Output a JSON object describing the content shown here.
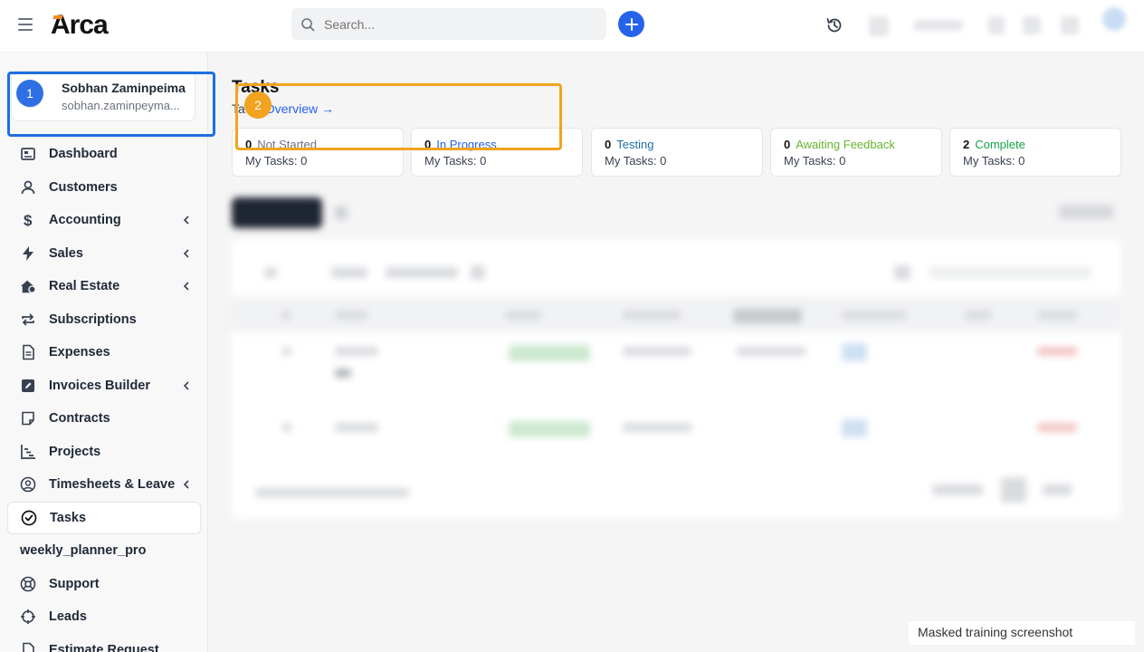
{
  "app": {
    "logo_text": "Arca",
    "search_placeholder": "Search..."
  },
  "user": {
    "name": "Sobhan Zaminpeima",
    "email": "sobhan.zaminpeyma..."
  },
  "badges": {
    "one": "1",
    "two": "2"
  },
  "sidebar": {
    "items": [
      {
        "label": "Dashboard",
        "icon": "dashboard-icon"
      },
      {
        "label": "Customers",
        "icon": "user-icon"
      },
      {
        "label": "Accounting",
        "icon": "dollar-icon",
        "has_children": true
      },
      {
        "label": "Sales",
        "icon": "bolt-icon",
        "has_children": true
      },
      {
        "label": "Real Estate",
        "icon": "house-icon",
        "has_children": true
      },
      {
        "label": "Subscriptions",
        "icon": "repeat-icon"
      },
      {
        "label": "Expenses",
        "icon": "file-icon"
      },
      {
        "label": "Invoices Builder",
        "icon": "edit-icon",
        "has_children": true
      },
      {
        "label": "Contracts",
        "icon": "note-icon"
      },
      {
        "label": "Projects",
        "icon": "chart-icon"
      },
      {
        "label": "Timesheets & Leave",
        "icon": "user-circle-icon",
        "has_children": true
      },
      {
        "label": "Tasks",
        "icon": "check-circle-icon",
        "active": true
      },
      {
        "label": "weekly_planner_pro",
        "icon": ""
      },
      {
        "label": "Support",
        "icon": "lifebuoy-icon"
      },
      {
        "label": "Leads",
        "icon": "crosshair-icon"
      },
      {
        "label": "Estimate Request",
        "icon": "file-icon"
      }
    ]
  },
  "main": {
    "title": "Tasks",
    "overview_prefix": "Ta",
    "overview_link": "Overview →",
    "stats": [
      {
        "count": "0",
        "label": "Not Started",
        "my_tasks": "My Tasks: 0",
        "color": "#6b7280"
      },
      {
        "count": "0",
        "label": "In Progress",
        "my_tasks": "My Tasks: 0",
        "color": "#2563eb"
      },
      {
        "count": "0",
        "label": "Testing",
        "my_tasks": "My Tasks: 0",
        "color": "#1d6fa5"
      },
      {
        "count": "0",
        "label": "Awaiting Feedback",
        "my_tasks": "My Tasks: 0",
        "color": "#65b32e"
      },
      {
        "count": "2",
        "label": "Complete",
        "my_tasks": "My Tasks: 0",
        "color": "#16a34a"
      }
    ]
  },
  "footer_note": "Masked training screenshot"
}
